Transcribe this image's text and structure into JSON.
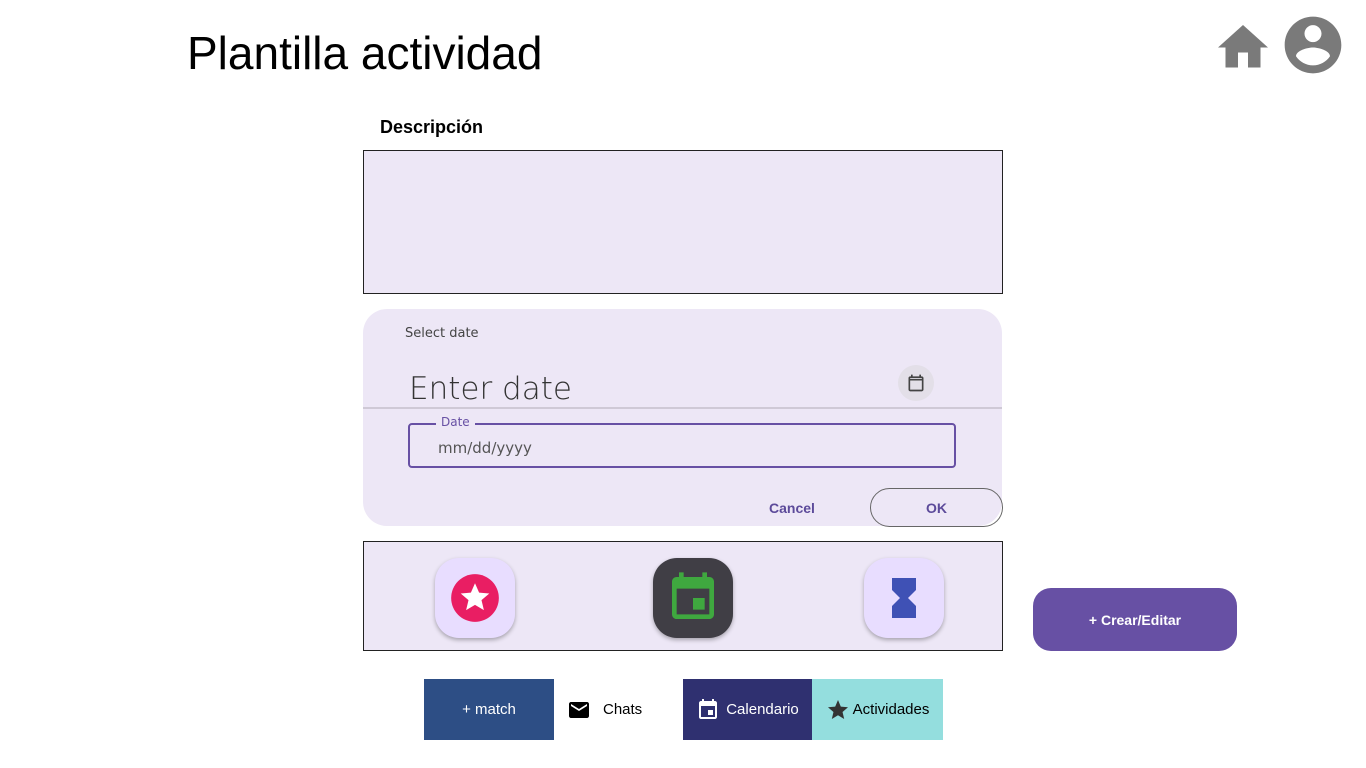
{
  "header": {
    "title": "Plantilla actividad",
    "home_icon": "home-icon",
    "avatar_icon": "account-circle-icon",
    "icon_color": "#7a7a7a"
  },
  "description": {
    "label": "Descripción",
    "value": ""
  },
  "date_picker": {
    "supporting_text": "Select date",
    "headline": "Enter date",
    "toggle_icon": "calendar-icon",
    "field_label": "Date",
    "field_placeholder": "mm/dd/yyyy",
    "cancel_label": "Cancel",
    "ok_label": "OK",
    "accent": "#6750a4"
  },
  "icon_strip": {
    "items": [
      {
        "icon": "star-icon",
        "color": "#e91e63"
      },
      {
        "icon": "event-icon",
        "color": "#3fa83f"
      },
      {
        "icon": "hourglass-icon",
        "color": "#3f51b5"
      }
    ]
  },
  "create_button": {
    "label": "+ Crear/Editar",
    "color": "#6750a4"
  },
  "navbar": {
    "items": [
      {
        "label": "+ match",
        "color": "#2d4e85"
      },
      {
        "label": "Chats",
        "icon": "mail-icon"
      },
      {
        "label": "Calendario",
        "icon": "calendar-icon",
        "color": "#2f3070"
      },
      {
        "label": "Actividades",
        "icon": "star-icon",
        "color": "#94dede"
      }
    ]
  }
}
